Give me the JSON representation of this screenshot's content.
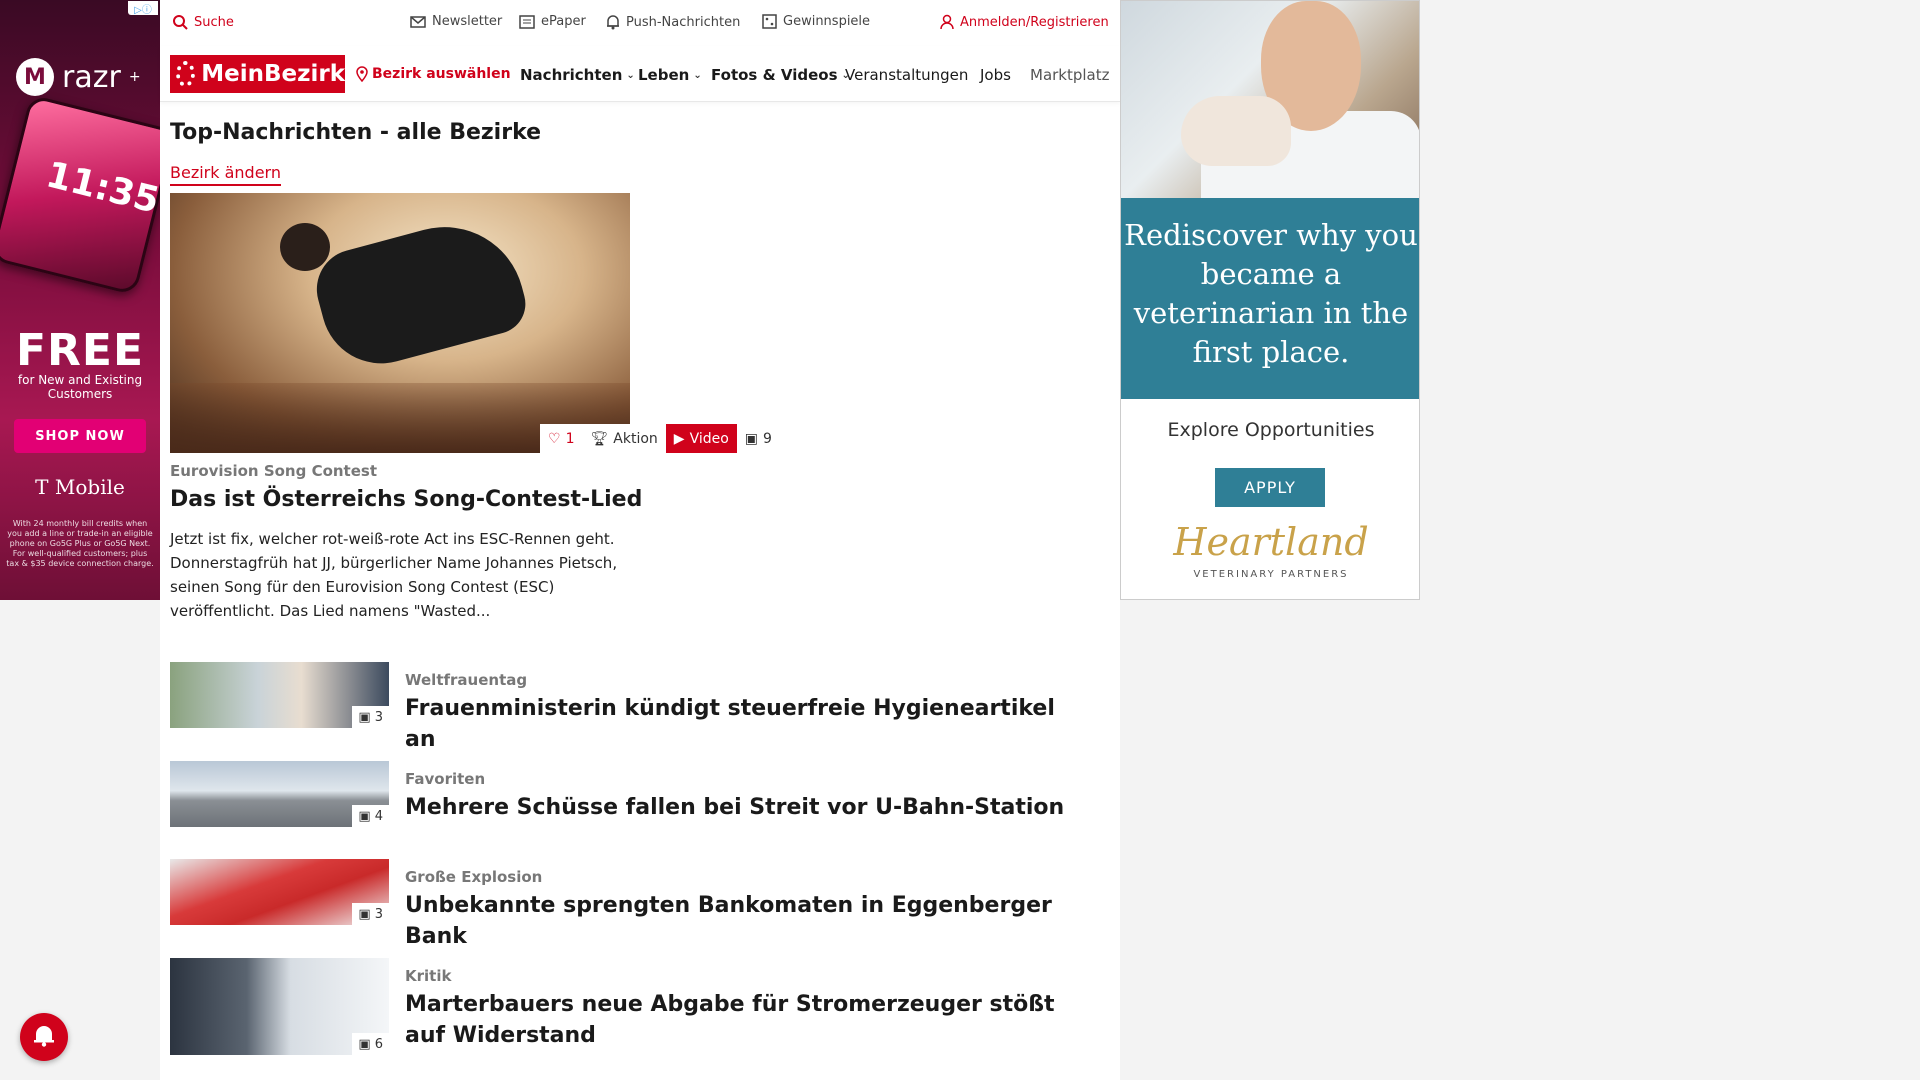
{
  "ad_left": {
    "brand": "razr",
    "brand_sup": "+",
    "phone_time": "11:35",
    "headline": "FREE",
    "subline": "for New and Existing Customers",
    "cta": "SHOP NOW",
    "advertiser": "T Mobile",
    "fine_print": "With 24 monthly bill credits when you add a line or trade-in an eligible phone on Go5G Plus or Go5G Next. For well-qualified customers; plus tax & $35 device connection charge."
  },
  "topbar": {
    "search": "Suche",
    "newsletter": "Newsletter",
    "epaper": "ePaper",
    "push": "Push-Nachrichten",
    "gewinnspiele": "Gewinnspiele",
    "login": "Anmelden/Registrieren"
  },
  "nav": {
    "logo": "MeinBezirk",
    "bezirk": "Bezirk auswählen",
    "items": [
      "Nachrichten",
      "Leben",
      "Fotos & Videos",
      "Veranstaltungen",
      "Jobs",
      "Marktplatz"
    ]
  },
  "section": {
    "title": "Top-Nachrichten - alle Bezirke",
    "change": "Bezirk ändern"
  },
  "hero": {
    "likes": "1",
    "aktion": "Aktion",
    "video": "Video",
    "photos": "9",
    "category": "Eurovision Song Contest",
    "title": "Das ist Österreichs Song-Contest-Lied",
    "teaser": "Jetzt ist fix, welcher rot-weiß-rote Act ins ESC-Rennen geht. Donnerstagfrüh hat JJ, bürgerlicher Name Johannes Pietsch, seinen Song für den Eurovision Song Contest (ESC) veröffentlicht. Das Lied namens \"Wasted..."
  },
  "articles": [
    {
      "category": "Weltfrauentag",
      "title": "Frauenministerin kündigt steuerfreie Hygieneartikel an",
      "photos": "3"
    },
    {
      "category": "Favoriten",
      "title": "Mehrere Schüsse fallen bei Streit vor U-Bahn-Station",
      "photos": "4"
    },
    {
      "category": "Große Explosion",
      "title": "Unbekannte sprengten Bankomaten in Eggenberger Bank",
      "photos": "3"
    },
    {
      "category": "Kritik",
      "title": "Marterbauers neue Abgabe für Stromerzeuger stößt auf Widerstand",
      "photos": "6"
    }
  ],
  "ad_right": {
    "headline": "Rediscover why you became a veterinarian in the first place.",
    "explore": "Explore Opportunities",
    "cta": "APPLY",
    "brand": "Heartland",
    "brand_sub": "VETERINARY PARTNERS"
  },
  "colors": {
    "accent": "#d0021b",
    "ad_teal": "#2f7f96",
    "heartland_gold": "#c9a24a"
  }
}
